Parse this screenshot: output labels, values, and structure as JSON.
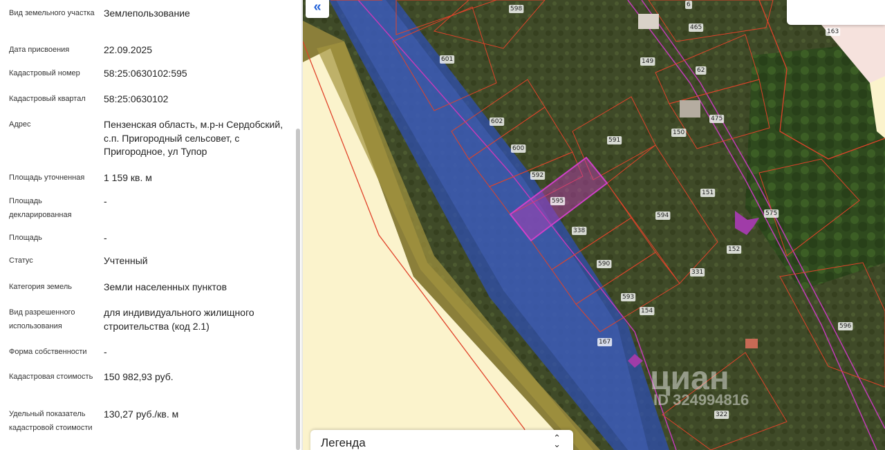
{
  "info": {
    "rows": [
      {
        "label": "Вид земельного участка",
        "value": "Землепользование"
      },
      {
        "label": "Дата присвоения",
        "value": "22.09.2025"
      },
      {
        "label": "Кадастровый номер",
        "value": "58:25:0630102:595"
      },
      {
        "label": "Кадастровый квартал",
        "value": "58:25:0630102"
      },
      {
        "label": "Адрес",
        "value": "Пензенская область, м.р-н Сердобский, с.п. Пригородный сельсовет, с Пригородное, ул Тупор"
      },
      {
        "label": "Площадь уточненная",
        "value": "1 159 кв. м"
      },
      {
        "label": "Площадь декларированная",
        "value": "-"
      },
      {
        "label": "Площадь",
        "value": "-"
      },
      {
        "label": "Статус",
        "value": "Учтенный"
      },
      {
        "label": "Категория земель",
        "value": "Земли населенных пунктов"
      },
      {
        "label": "Вид разрешенного использования",
        "value": "для индивидуального жилищного строительства (код 2.1)"
      },
      {
        "label": "Форма собственности",
        "value": "-"
      },
      {
        "label": "Кадастровая стоимость",
        "value": "150 982,93 руб."
      },
      {
        "label": "Удельный показатель кадастровой стоимости",
        "value": "130,27 руб./кв. м"
      }
    ]
  },
  "map": {
    "collapse_icon": "«",
    "legend_label": "Легенда",
    "legend_icon": "⌃⌄",
    "watermark_brand": "циан",
    "watermark_id": "ID 324994816",
    "plot_labels": [
      "598",
      "6",
      "465",
      "163",
      "601",
      "149",
      "62",
      "602",
      "591",
      "150",
      "475",
      "600",
      "592",
      "151",
      "595",
      "594",
      "575",
      "338",
      "152",
      "590",
      "331",
      "593",
      "154",
      "596",
      "167",
      "322"
    ]
  },
  "colors": {
    "accent": "#1f5fd8",
    "selected_plot": "#c23bb8",
    "plot_border": "#e0432a",
    "road_blue": "#2f4fb0"
  }
}
